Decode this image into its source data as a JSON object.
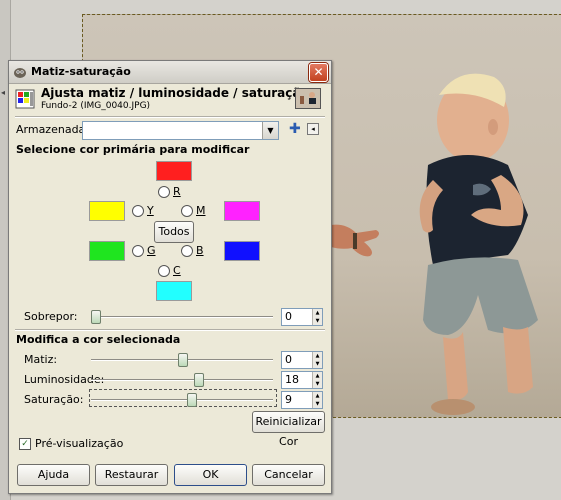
{
  "dialog": {
    "title": "Matiz-saturação",
    "header_title": "Ajusta matiz / luminosidade / saturação",
    "header_subtitle": "Fundo-2 (IMG_0040.JPG)",
    "presets_label": "Armazenadas:",
    "presets_value": "",
    "section_primary": "Selecione cor primária para modificar",
    "colors": {
      "red": {
        "label": "R",
        "hex": "#ff1f1f"
      },
      "yellow": {
        "label": "Y",
        "hex": "#ffff00"
      },
      "magenta": {
        "label": "M",
        "hex": "#ff22ff"
      },
      "green": {
        "label": "G",
        "hex": "#1fe51f"
      },
      "blue": {
        "label": "B",
        "hex": "#1010ff"
      },
      "cyan": {
        "label": "C",
        "hex": "#22ffff"
      }
    },
    "all_button": "Todos",
    "overlap": {
      "label": "Sobrepor:",
      "value": "0"
    },
    "section_modify": "Modifica a cor selecionada",
    "hue": {
      "label": "Matiz:",
      "value": "0"
    },
    "lightness": {
      "label": "Luminosidade:",
      "value": "18"
    },
    "saturation": {
      "label": "Saturação:",
      "value": "9"
    },
    "reset_color_button": "Reinicializar Cor",
    "preview": {
      "label": "Pré-visualização",
      "checked": true
    },
    "buttons": {
      "help": "Ajuda",
      "reset": "Restaurar",
      "ok": "OK",
      "cancel": "Cancelar"
    }
  }
}
